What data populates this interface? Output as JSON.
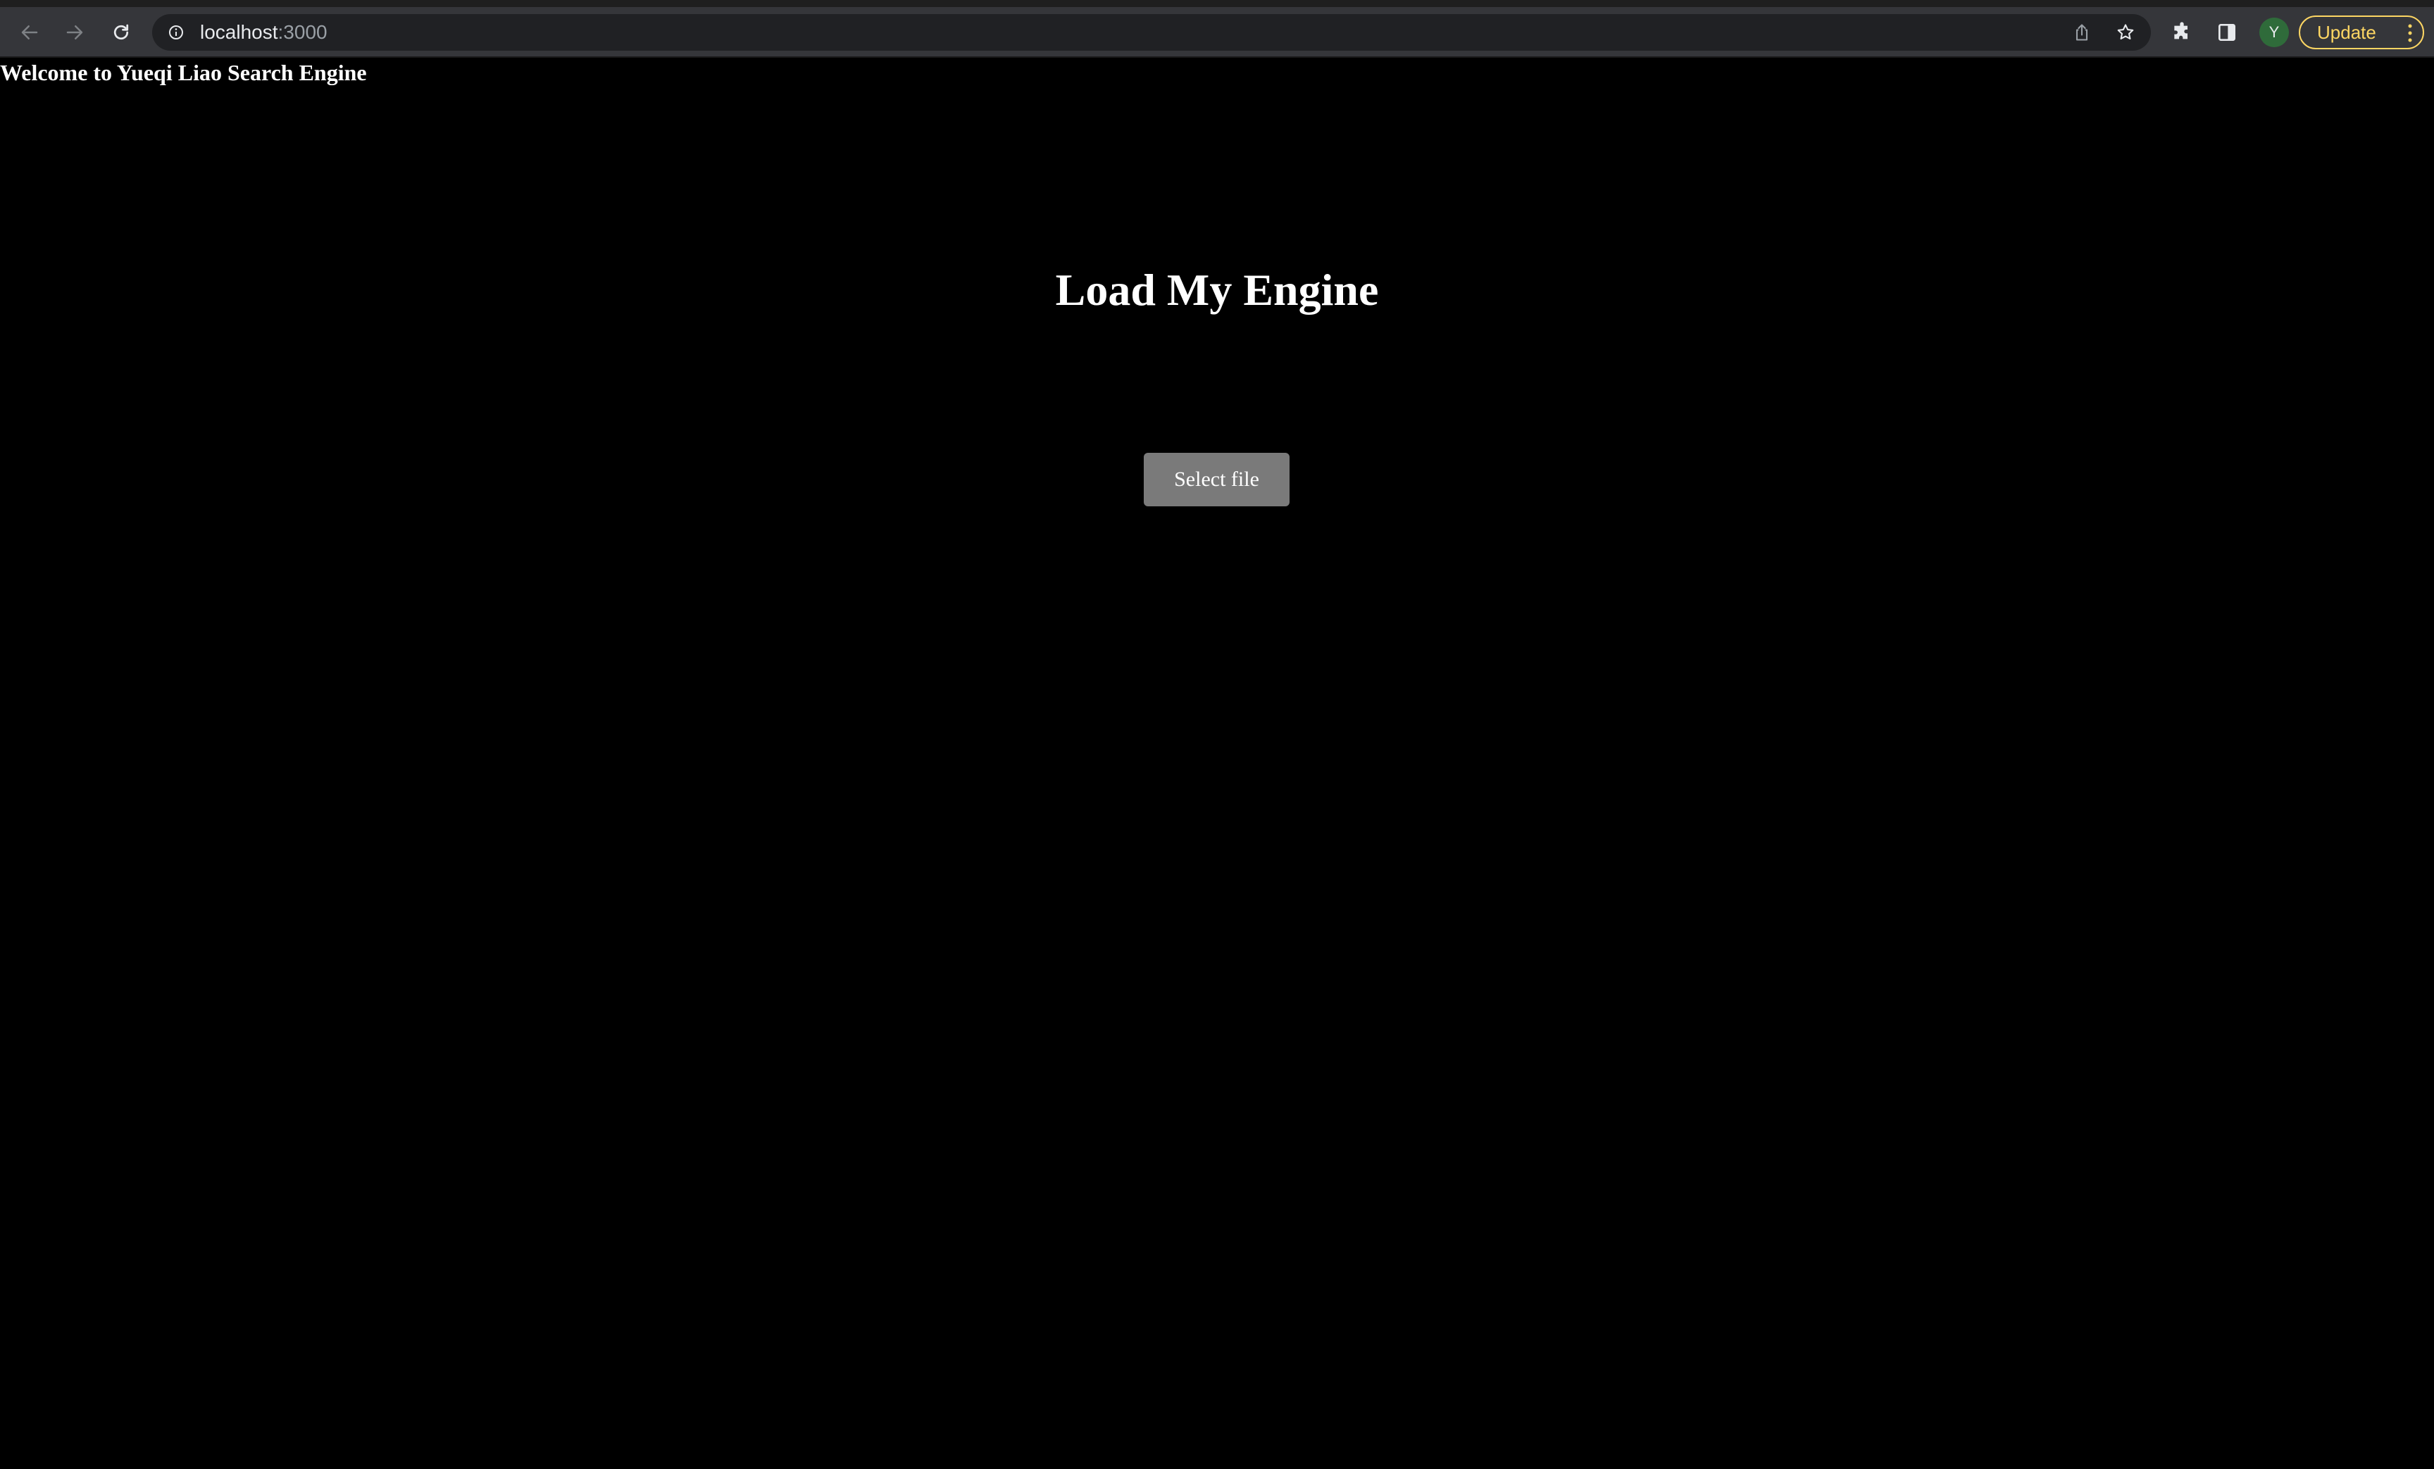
{
  "browser": {
    "url_host": "localhost",
    "url_port": ":3000",
    "profile_initial": "Y",
    "update_label": "Update",
    "accent_color": "#fdd663",
    "icons": {
      "back": "arrow-left-icon",
      "forward": "arrow-right-icon",
      "reload": "reload-icon",
      "site_info": "info-icon",
      "share": "share-icon",
      "bookmark": "star-icon",
      "extensions": "puzzle-icon",
      "side_panel": "side-panel-icon",
      "menu": "kebab-menu-icon"
    }
  },
  "page": {
    "welcome_text": "Welcome to Yueqi Liao Search Engine",
    "title": "Load My Engine",
    "select_file_label": "Select file",
    "background_color": "#000000",
    "button_color": "#7a7a7a"
  }
}
